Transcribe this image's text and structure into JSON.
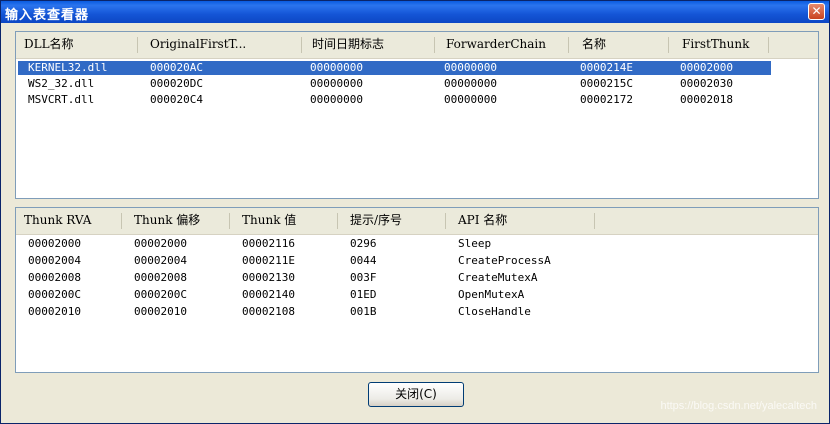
{
  "window": {
    "title": "输入表查看器",
    "close_symbol": "✕"
  },
  "dll_list": {
    "columns": [
      "DLL名称",
      "OriginalFirstT...",
      "时间日期标志",
      "ForwarderChain",
      "名称",
      "FirstThunk"
    ],
    "rows": [
      [
        "KERNEL32.dll",
        "000020AC",
        "00000000",
        "00000000",
        "0000214E",
        "00002000"
      ],
      [
        "WS2_32.dll",
        "000020DC",
        "00000000",
        "00000000",
        "0000215C",
        "00002030"
      ],
      [
        "MSVCRT.dll",
        "000020C4",
        "00000000",
        "00000000",
        "00002172",
        "00002018"
      ]
    ]
  },
  "thunk_list": {
    "columns": [
      "Thunk RVA",
      "Thunk 偏移",
      "Thunk 值",
      "提示/序号",
      "API 名称"
    ],
    "rows": [
      [
        "00002000",
        "00002000",
        "00002116",
        "0296",
        "Sleep"
      ],
      [
        "00002004",
        "00002004",
        "0000211E",
        "0044",
        "CreateProcessA"
      ],
      [
        "00002008",
        "00002008",
        "00002130",
        "003F",
        "CreateMutexA"
      ],
      [
        "0000200C",
        "0000200C",
        "00002140",
        "01ED",
        "OpenMutexA"
      ],
      [
        "00002010",
        "00002010",
        "00002108",
        "001B",
        "CloseHandle"
      ]
    ]
  },
  "buttons": {
    "close_label": "关闭(C)"
  },
  "watermark": "https://blog.csdn.net/yalecaltech",
  "colors": {
    "title_bar": "#0a5be0",
    "selection": "#316ac5"
  }
}
